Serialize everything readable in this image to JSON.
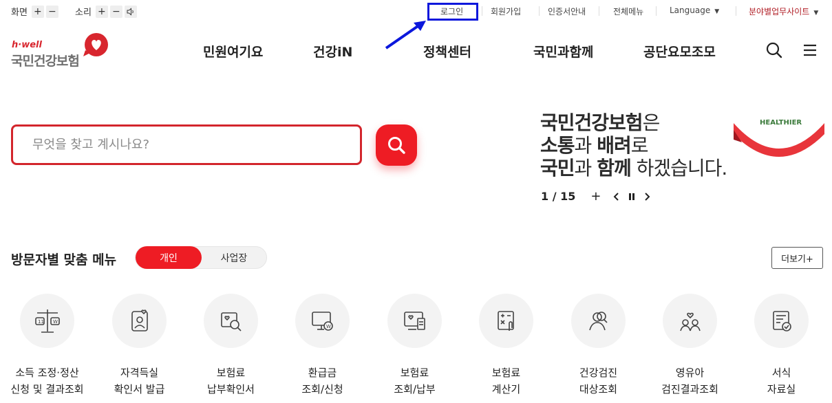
{
  "utility": {
    "text_size_label": "화면",
    "sound_label": "소리",
    "plus": "+",
    "minus": "−",
    "links": {
      "login": "로그인",
      "signup": "회원가입",
      "cert": "인증서안내",
      "sitemap": "전체메뉴",
      "language": "Language",
      "business_sites": "분야별업무사이트"
    }
  },
  "logo": {
    "sub": "h·well",
    "name": "국민건강보험"
  },
  "gnb": [
    "민원여기요",
    "건강iN",
    "정책센터",
    "국민과함께",
    "공단요모조모"
  ],
  "search": {
    "placeholder": "무엇을 찾고 계시나요?"
  },
  "slogan": {
    "line1_bold": "국민건강보험",
    "line1_rest": "은",
    "line2_bold1": "소통",
    "line2_mid": "과 ",
    "line2_bold2": "배려",
    "line2_rest": "로",
    "line3_bold1": "국민",
    "line3_mid": "과 ",
    "line3_bold2": "함께",
    "line3_rest": " 하겠습니다.",
    "badge_text": "HEALTHIER"
  },
  "pager": {
    "current": "1",
    "total": "15",
    "separator": "/"
  },
  "visitor": {
    "title": "방문자별 맞춤 메뉴",
    "tab_personal": "개인",
    "tab_business": "사업장",
    "more": "더보기+",
    "items": [
      {
        "line1": "소득 조정·정산",
        "line2": "신청 및 결과조회"
      },
      {
        "line1": "자격득실",
        "line2": "확인서 발급"
      },
      {
        "line1": "보험료",
        "line2": "납부확인서"
      },
      {
        "line1": "환급금",
        "line2": "조회/신청"
      },
      {
        "line1": "보험료",
        "line2": "조회/납부"
      },
      {
        "line1": "보험료",
        "line2": "계산기"
      },
      {
        "line1": "건강검진",
        "line2": "대상조회"
      },
      {
        "line1": "영유아",
        "line2": "검진결과조회"
      },
      {
        "line1": "서식",
        "line2": "자료실"
      }
    ]
  },
  "colors": {
    "brand_red": "#ee1c24",
    "highlight_blue": "#0b17dc"
  }
}
